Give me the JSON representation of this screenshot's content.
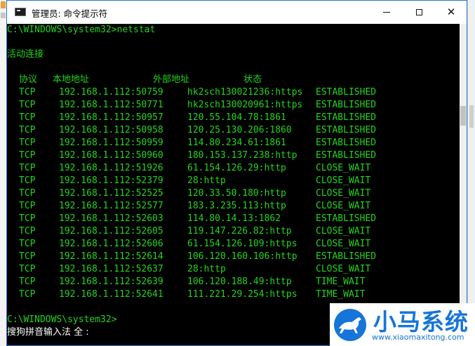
{
  "window": {
    "title": "管理员: 命令提示符"
  },
  "console": {
    "prompt_command": "C:\\WINDOWS\\system32>netstat",
    "section_title": "活动连接",
    "headers": [
      "协议",
      "本地地址",
      "外部地址",
      "状态"
    ],
    "rows": [
      {
        "proto": "TCP",
        "local": "192.168.1.112:50759",
        "foreign": "hk2sch130021236:https",
        "state": "ESTABLISHED"
      },
      {
        "proto": "TCP",
        "local": "192.168.1.112:50771",
        "foreign": "hk2sch130020961:https",
        "state": "ESTABLISHED"
      },
      {
        "proto": "TCP",
        "local": "192.168.1.112:50957",
        "foreign": "120.55.104.78:1861",
        "state": "ESTABLISHED"
      },
      {
        "proto": "TCP",
        "local": "192.168.1.112:50958",
        "foreign": "120.25.130.206:1860",
        "state": "ESTABLISHED"
      },
      {
        "proto": "TCP",
        "local": "192.168.1.112:50959",
        "foreign": "114.80.234.61:1861",
        "state": "ESTABLISHED"
      },
      {
        "proto": "TCP",
        "local": "192.168.1.112:50960",
        "foreign": "180.153.137.238:http",
        "state": "ESTABLISHED"
      },
      {
        "proto": "TCP",
        "local": "192.168.1.112:51926",
        "foreign": "61.154.126.29:http",
        "state": "CLOSE_WAIT"
      },
      {
        "proto": "TCP",
        "local": "192.168.1.112:52379",
        "foreign": "28:http",
        "state": "CLOSE_WAIT"
      },
      {
        "proto": "TCP",
        "local": "192.168.1.112:52525",
        "foreign": "120.33.50.180:http",
        "state": "CLOSE_WAIT"
      },
      {
        "proto": "TCP",
        "local": "192.168.1.112:52577",
        "foreign": "183.3.235.113:http",
        "state": "CLOSE_WAIT"
      },
      {
        "proto": "TCP",
        "local": "192.168.1.112:52603",
        "foreign": "114.80.14.13:1862",
        "state": "ESTABLISHED"
      },
      {
        "proto": "TCP",
        "local": "192.168.1.112:52605",
        "foreign": "119.147.226.82:http",
        "state": "CLOSE_WAIT"
      },
      {
        "proto": "TCP",
        "local": "192.168.1.112:52606",
        "foreign": "61.154.126.109:https",
        "state": "CLOSE_WAIT"
      },
      {
        "proto": "TCP",
        "local": "192.168.1.112:52614",
        "foreign": "106.120.160.106:http",
        "state": "ESTABLISHED"
      },
      {
        "proto": "TCP",
        "local": "192.168.1.112:52637",
        "foreign": "28:http",
        "state": "CLOSE_WAIT"
      },
      {
        "proto": "TCP",
        "local": "192.168.1.112:52639",
        "foreign": "106.120.188.49:http",
        "state": "TIME_WAIT"
      },
      {
        "proto": "TCP",
        "local": "192.168.1.112:52641",
        "foreign": "111.221.29.254:https",
        "state": "TIME_WAIT"
      }
    ],
    "final_prompt": "C:\\WINDOWS\\system32>",
    "ime_status": "搜狗拼音输入法 全 :"
  },
  "watermark": {
    "title": "小马系统",
    "url": "www.xiaomaxitong.com"
  },
  "colors": {
    "console_text": "#23d41c",
    "console_bg": "#000000",
    "watermark": "#1675d8"
  }
}
